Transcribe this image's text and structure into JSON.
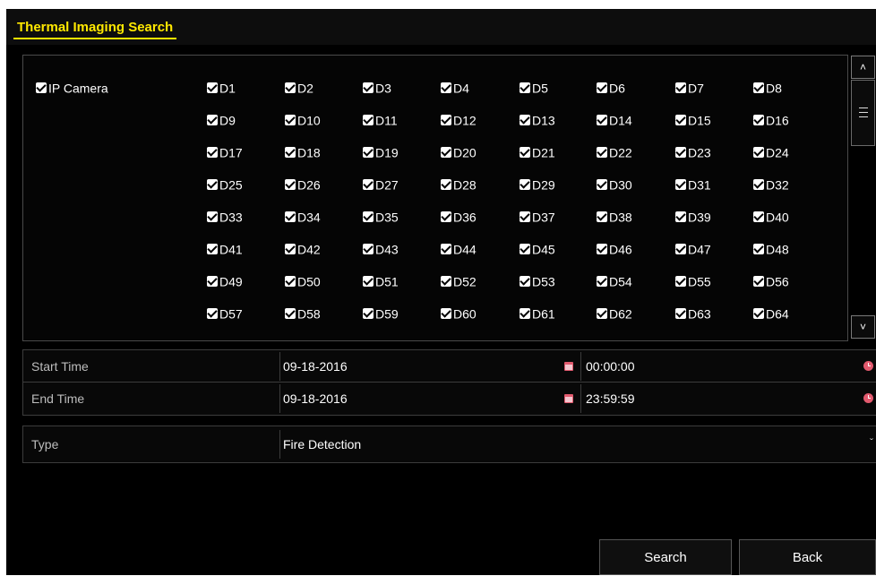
{
  "title": "Thermal Imaging Search",
  "camera_group": {
    "label": "IP Camera",
    "checked": true
  },
  "cameras": [
    [
      "D1",
      "D2",
      "D3",
      "D4",
      "D5",
      "D6",
      "D7",
      "D8"
    ],
    [
      "D9",
      "D10",
      "D11",
      "D12",
      "D13",
      "D14",
      "D15",
      "D16"
    ],
    [
      "D17",
      "D18",
      "D19",
      "D20",
      "D21",
      "D22",
      "D23",
      "D24"
    ],
    [
      "D25",
      "D26",
      "D27",
      "D28",
      "D29",
      "D30",
      "D31",
      "D32"
    ],
    [
      "D33",
      "D34",
      "D35",
      "D36",
      "D37",
      "D38",
      "D39",
      "D40"
    ],
    [
      "D41",
      "D42",
      "D43",
      "D44",
      "D45",
      "D46",
      "D47",
      "D48"
    ],
    [
      "D49",
      "D50",
      "D51",
      "D52",
      "D53",
      "D54",
      "D55",
      "D56"
    ],
    [
      "D57",
      "D58",
      "D59",
      "D60",
      "D61",
      "D62",
      "D63",
      "D64"
    ]
  ],
  "start_time": {
    "label": "Start Time",
    "date": "09-18-2016",
    "time": "00:00:00"
  },
  "end_time": {
    "label": "End Time",
    "date": "09-18-2016",
    "time": "23:59:59"
  },
  "type": {
    "label": "Type",
    "value": "Fire Detection"
  },
  "buttons": {
    "search": "Search",
    "back": "Back"
  },
  "icons": {
    "date": "calendar-icon",
    "time": "clock-icon",
    "dropdown": "chevron-down-icon",
    "scroll_up": "scroll-up-icon",
    "scroll_down": "scroll-down-icon"
  },
  "colors": {
    "accent": "#ffe800",
    "icon": "#e25a6e",
    "background": "#000000"
  }
}
